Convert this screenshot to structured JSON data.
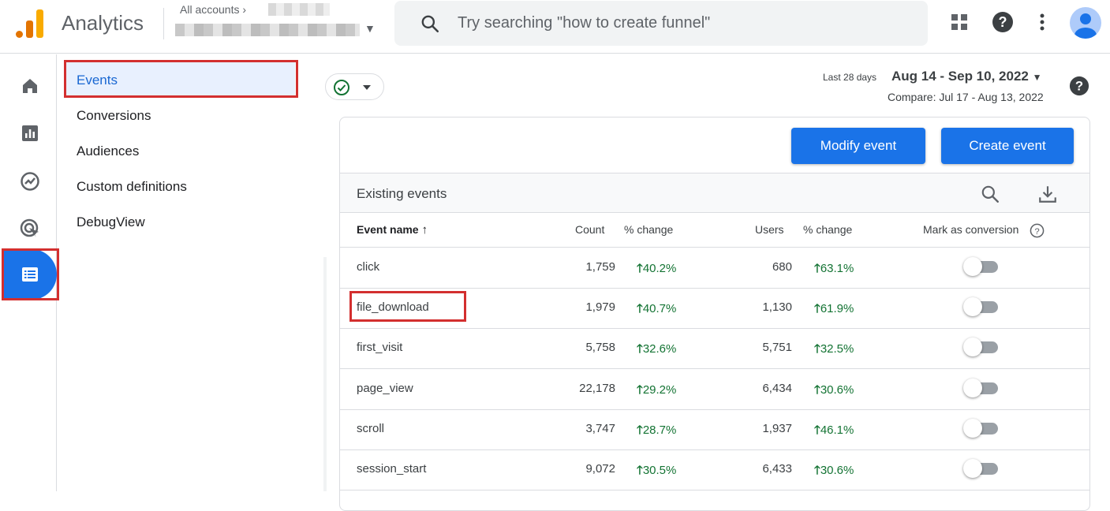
{
  "app": {
    "title": "Analytics",
    "account_label": "All accounts",
    "brand_colors": [
      "#f9ab00",
      "#e37400"
    ]
  },
  "search": {
    "placeholder": "Try searching \"how to create funnel\""
  },
  "topbar_icons": [
    "apps-grid-icon",
    "help-icon",
    "more-vert-icon",
    "avatar"
  ],
  "left_rail": [
    "home-icon",
    "reports-icon",
    "explore-icon",
    "advertising-icon",
    "configure-icon"
  ],
  "subnav": {
    "items": [
      {
        "label": "Events",
        "active": true
      },
      {
        "label": "Conversions"
      },
      {
        "label": "Audiences"
      },
      {
        "label": "Custom definitions"
      },
      {
        "label": "DebugView"
      }
    ]
  },
  "date": {
    "label": "Last 28 days",
    "range": "Aug 14 - Sep 10, 2022",
    "compare": "Compare: Jul 17 - Aug 13, 2022"
  },
  "buttons": {
    "modify": "Modify event",
    "create": "Create event"
  },
  "table": {
    "title": "Existing events",
    "headers": {
      "event_name": "Event name",
      "count": "Count",
      "count_change": "% change",
      "users": "Users",
      "users_change": "% change",
      "mark": "Mark as conversion"
    },
    "rows": [
      {
        "name": "click",
        "count": "1,759",
        "count_change": "40.2%",
        "users": "680",
        "users_change": "63.1%"
      },
      {
        "name": "file_download",
        "count": "1,979",
        "count_change": "40.7%",
        "users": "1,130",
        "users_change": "61.9%"
      },
      {
        "name": "first_visit",
        "count": "5,758",
        "count_change": "32.6%",
        "users": "5,751",
        "users_change": "32.5%"
      },
      {
        "name": "page_view",
        "count": "22,178",
        "count_change": "29.2%",
        "users": "6,434",
        "users_change": "30.6%"
      },
      {
        "name": "scroll",
        "count": "3,747",
        "count_change": "28.7%",
        "users": "1,937",
        "users_change": "46.1%"
      },
      {
        "name": "session_start",
        "count": "9,072",
        "count_change": "30.5%",
        "users": "6,433",
        "users_change": "30.6%"
      }
    ]
  },
  "colors": {
    "accent": "#1a73e8",
    "positive": "#137333",
    "highlight": "#d32f2f"
  }
}
